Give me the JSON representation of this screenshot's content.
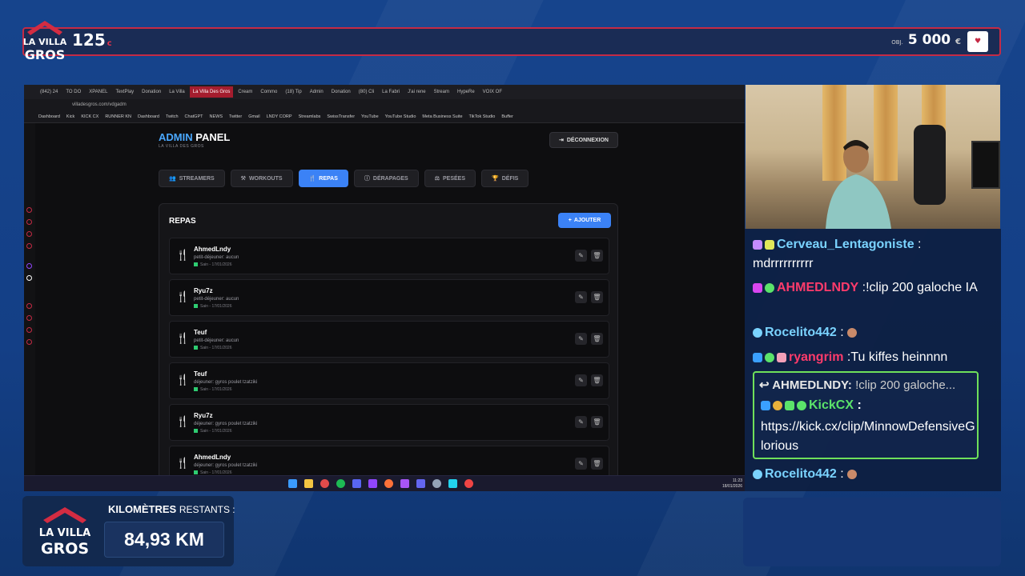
{
  "overlay": {
    "coins": "125",
    "coin_symbol": "c",
    "donation_label": "OBJ.",
    "donation_value": "5 000",
    "donation_currency": "€",
    "logo_text": "LA VILLA DES GROS",
    "km_label_bold": "KILOMÈTRES",
    "km_label_rest": "RESTANTS :",
    "km_value": "84,93 KM"
  },
  "browser": {
    "tabs": [
      "(842) 24",
      "TO DO",
      "XPANEL",
      "TextPlay",
      "Donation",
      "La Villa",
      "La Villa Des Gros",
      "Cream",
      "Commo",
      "(18) Tip",
      "Admin",
      "Donation",
      "(80) Cli",
      "La Fabri",
      "J'ai rene",
      "Stream",
      "HypeRe",
      "VOIX OF"
    ],
    "active_tab_index": 6,
    "url": "villadesgros.com/vdgadm",
    "bookmarks": [
      "Dashboard",
      "Kick",
      "KICK CX",
      "RUNNER KN",
      "Dashboard",
      "Twitch",
      "ChatGPT",
      "NEWS",
      "Twitter",
      "Gmail",
      "LNDY CORP",
      "Streamlabs",
      "SwissTransfer",
      "YouTube",
      "YouTube Studio",
      "Meta Business Suite",
      "TikTok Studio",
      "Buffer"
    ],
    "clock_time": "11:23",
    "clock_date": "18/01/2026"
  },
  "admin": {
    "title_blue": "ADMIN",
    "title_white": "PANEL",
    "subtitle": "LA VILLA DES GROS",
    "logout_label": "DÉCONNEXION",
    "tabs": [
      {
        "label": "STREAMERS",
        "active": false
      },
      {
        "label": "WORKOUTS",
        "active": false
      },
      {
        "label": "REPAS",
        "active": true
      },
      {
        "label": "DÉRAPAGES",
        "active": false
      },
      {
        "label": "PESÉES",
        "active": false
      },
      {
        "label": "DÉFIS",
        "active": false
      }
    ],
    "section_title": "REPAS",
    "add_label": "AJOUTER",
    "rows": [
      {
        "name": "AhmedLndy",
        "meal": "petit-déjeuner: aucun",
        "status": "Sain - 17/01/2026"
      },
      {
        "name": "Ryu7z",
        "meal": "petit-déjeuner: aucun",
        "status": "Sain - 17/01/2026"
      },
      {
        "name": "Teuf",
        "meal": "petit-déjeuner: aucun",
        "status": "Sain - 17/01/2026"
      },
      {
        "name": "Teuf",
        "meal": "déjeuner: gyros poulet tzatziki",
        "status": "Sain - 17/01/2026"
      },
      {
        "name": "Ryu7z",
        "meal": "déjeuner: gyros poulet tzatziki",
        "status": "Sain - 17/01/2026"
      },
      {
        "name": "AhmedLndy",
        "meal": "déjeuner: gyros poulet tzatziki",
        "status": "Sain - 17/01/2026"
      }
    ]
  },
  "chat": {
    "messages": [
      {
        "user": "Cerveau_Lentagoniste",
        "sep": " :",
        "text": "mdrrrrrrrrrr"
      },
      {
        "user": "AHMEDLNDY",
        "sep": " :",
        "text": "!clip 200 galoche IA"
      },
      {
        "user": "Rocelito442",
        "sep": " :",
        "text": ""
      },
      {
        "user": "ryangrim",
        "sep": " :",
        "text": "Tu kiffes heinnnn"
      }
    ],
    "reply": {
      "quoted_user": "AHMEDLNDY:",
      "quoted_text": "!clip 200 galoche...",
      "user": "KickCX",
      "sep": " :",
      "text": "https://kick.cx/clip/MinnowDefensiveGlorious"
    },
    "last": {
      "user": "Rocelito442",
      "sep": " :"
    }
  },
  "colors": {
    "accent_red": "#c52a45",
    "accent_blue": "#3b82f6",
    "chat_green": "#5be36a"
  }
}
